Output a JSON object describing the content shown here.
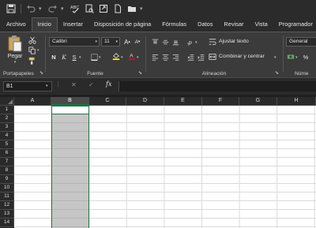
{
  "qat": {
    "icons": [
      "save-icon",
      "undo-icon",
      "redo-icon",
      "spelling-icon",
      "print-preview-icon",
      "share-icon",
      "new-file-icon",
      "open-folder-icon",
      "customize-icon"
    ]
  },
  "tabs": [
    "Archivo",
    "Inicio",
    "Insertar",
    "Disposición de página",
    "Fórmulas",
    "Datos",
    "Revisar",
    "Vista",
    "Programador"
  ],
  "active_tab": "Inicio",
  "ribbon": {
    "clipboard": {
      "paste_label": "Pegar",
      "group_label": "Portapapeles"
    },
    "font": {
      "font_name": "Calibri",
      "font_size": "11",
      "bold": "N",
      "italic": "K",
      "underline": "S",
      "group_label": "Fuente"
    },
    "alignment": {
      "wrap_text": "Ajustar texto",
      "merge_center": "Combinar y centrar",
      "group_label": "Alineación"
    },
    "number": {
      "format": "General",
      "group_label": "Núme"
    }
  },
  "formula_bar": {
    "name_box": "B1",
    "fx_label": "fx",
    "formula": ""
  },
  "grid": {
    "columns": [
      "A",
      "B",
      "C",
      "D",
      "E",
      "F",
      "G",
      "H"
    ],
    "rows": [
      "1",
      "2",
      "3",
      "4",
      "5",
      "6",
      "7",
      "8",
      "9",
      "10",
      "11",
      "12",
      "13",
      "14"
    ],
    "selected_column": "B",
    "active_cell": "B1"
  },
  "colors": {
    "selection_border": "#217346",
    "ribbon_bg": "#3b3b3b",
    "title_bg": "#2b2b2b",
    "font_color_swatch": "#ff0000",
    "highlight_swatch": "#ffff00"
  }
}
